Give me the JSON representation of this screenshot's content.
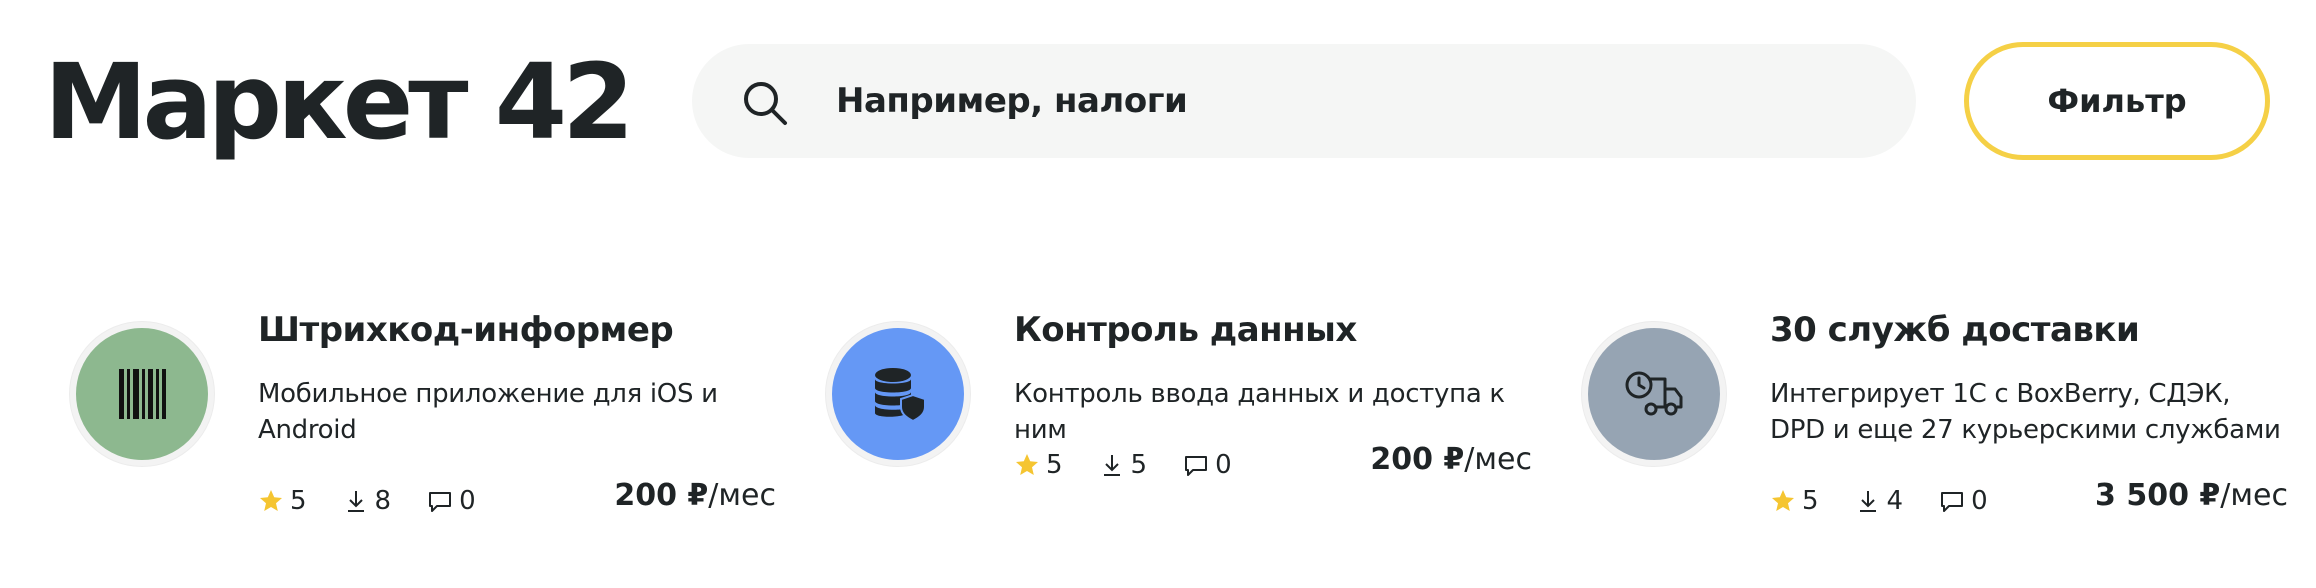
{
  "header": {
    "title": "Маркет 42",
    "search": {
      "placeholder": "Например, налоги",
      "icon": "search-icon"
    },
    "filter_label": "Фильтр"
  },
  "colors": {
    "text": "#1f2426",
    "search_bg": "#f5f6f5",
    "filter_border": "#f5d046",
    "star": "#f5c531"
  },
  "cards": [
    {
      "title": "Штрихкод-информер",
      "description": "Мобильное приложение для iOS и Android",
      "icon": "barcode-icon",
      "icon_bg": "#8db88f",
      "rating": "5",
      "downloads": "8",
      "comments": "0",
      "price": "200 ₽",
      "period": "/мес"
    },
    {
      "title": "Контроль данных",
      "description": "Контроль ввода данных и доступа к ним",
      "icon": "database-shield-icon",
      "icon_bg": "#6598f5",
      "rating": "5",
      "downloads": "5",
      "comments": "0",
      "price": "200 ₽",
      "period": "/мес"
    },
    {
      "title": "30 служб доставки",
      "description": "Интегрирует 1С с BoxBerry, СДЭК, DPD и еще 27 курьерскими службами",
      "icon": "delivery-truck-icon",
      "icon_bg": "#96a4b3",
      "rating": "5",
      "downloads": "4",
      "comments": "0",
      "price": "3 500 ₽",
      "period": "/мес"
    }
  ]
}
